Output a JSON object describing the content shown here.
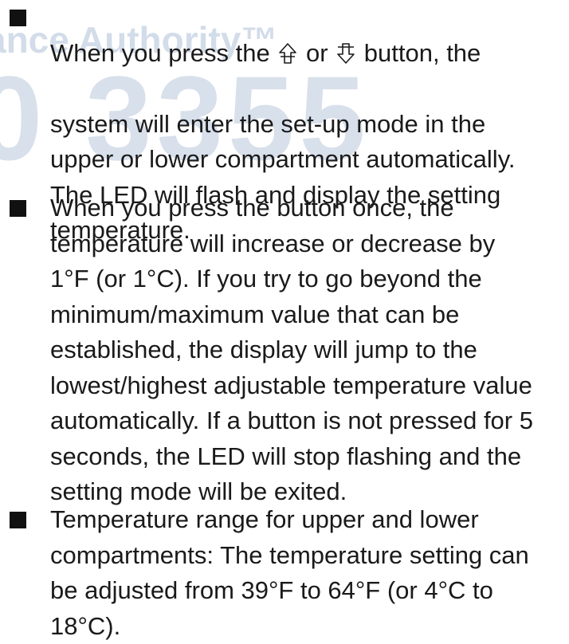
{
  "watermark": {
    "line1": "ance Authority™",
    "line2": "0 3355",
    "color": "#b9c7db"
  },
  "items": [
    {
      "first_before": "When you press the",
      "up_icon": "up-arrow-icon",
      "first_middle": "or",
      "down_icon": "down-arrow-icon",
      "first_after": "button, the",
      "rest": "system will enter the set-up mode in the\nupper or lower compartment automatically.\nThe LED will flash and display the setting\ntemperature."
    },
    {
      "text": "When you press the button once, the\ntemperature will increase or decrease by\n1°F (or 1°C). If you try to go beyond the\nminimum/maximum value that can be\nestablished, the display will jump to the\nlowest/highest adjustable temperature value\nautomatically. If a button is not pressed for 5\nseconds, the LED will stop flashing and the\nsetting mode will be exited."
    },
    {
      "text": "Temperature range for upper and lower\ncompartments: The temperature setting can\nbe adjusted from 39°F to 64°F (or 4°C to\n18°C)."
    }
  ]
}
